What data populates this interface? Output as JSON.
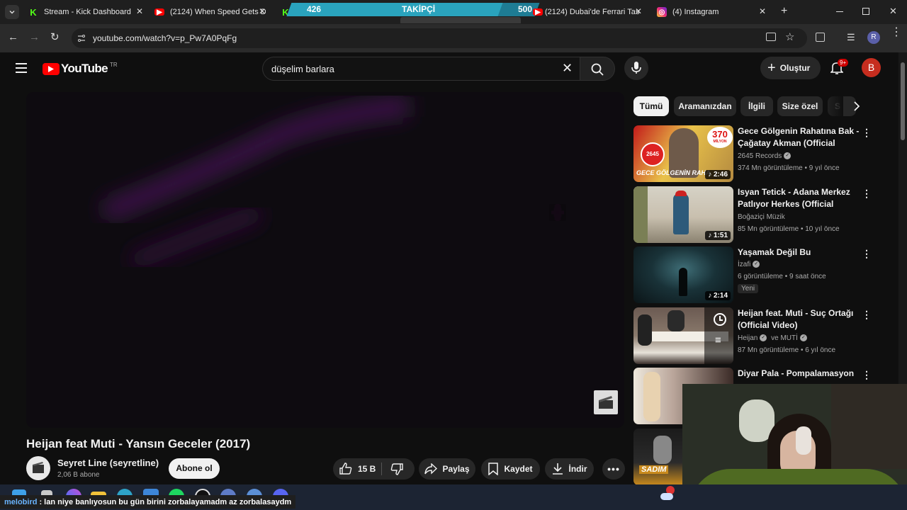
{
  "browser": {
    "tabs": [
      {
        "title": "Stream - Kick Dashboard",
        "icon": "kick-icon"
      },
      {
        "title": "(2124) When Speed Gets D",
        "icon": "youtube-icon"
      },
      {
        "title": "",
        "icon": "kick-icon"
      },
      {
        "title": "(2124) Dubai'de Ferrari Tas",
        "icon": "youtube-icon"
      },
      {
        "title": "(4) Instagram",
        "icon": "instagram-icon"
      }
    ],
    "url": "youtube.com/watch?v=p_Pw7A0PqFg",
    "profile_initial": "R"
  },
  "follow_overlay": {
    "current": "426",
    "label": "TAKİPÇİ",
    "goal": "500",
    "progress_fraction": 0.852
  },
  "youtube": {
    "logo_text": "YouTube",
    "region": "TR",
    "search_query": "düşelim barlara",
    "create_label": "Oluştur",
    "notifications_badge": "9+",
    "avatar_initial": "B"
  },
  "video": {
    "title": "Heijan feat Muti - Yansın Geceler (2017)",
    "channel_name": "Seyret Line (seyretline)",
    "subscribers": "2,06 B abone",
    "subscribe_label": "Abone ol",
    "likes": "15 B",
    "share_label": "Paylaş",
    "save_label": "Kaydet",
    "download_label": "İndir"
  },
  "chips": [
    "Tümü",
    "Aramanızdan",
    "İlgili",
    "Size özel",
    "S"
  ],
  "recommendations": [
    {
      "title": "Gece Gölgenin Rahatına Bak - Çağatay Akman (Official  Video)",
      "channel": "2645 Records",
      "verified": true,
      "meta": "374 Mn görüntüleme • 9 yıl önce",
      "duration": "2:46",
      "thumb_badge": "370",
      "thumb_badge_sub": "MİLYON",
      "thumb_text": "GECE GÖLGENİN RAHA",
      "thumb_logo": "2645",
      "badge": ""
    },
    {
      "title": "Isyan Tetick - Adana Merkez Patlıyor Herkes (Official Video)",
      "channel": "Boğaziçi Müzik",
      "verified": false,
      "meta": "85 Mn görüntüleme • 10 yıl önce",
      "duration": "1:51",
      "badge": ""
    },
    {
      "title": "Yaşamak Değil Bu",
      "channel": "İzafi",
      "verified": true,
      "meta": "6 görüntüleme • 9 saat önce",
      "duration": "2:14",
      "badge": "Yeni"
    },
    {
      "title": "Heijan feat. Muti - Suç Ortağı (Official Video)",
      "channel": "Heijan",
      "channel2": "ve MUTİ",
      "verified": true,
      "meta": "87 Mn görüntüleme • 6 yıl önce",
      "duration": "",
      "badge": ""
    },
    {
      "title": "Diyar Pala - Pompalamasyon",
      "channel": "",
      "verified": false,
      "meta": "",
      "duration": "",
      "badge": ""
    },
    {
      "title": "",
      "channel": "",
      "verified": false,
      "meta": "",
      "duration": "",
      "badge": "",
      "thumb_text": "SADIM"
    }
  ],
  "chat": {
    "user": "melobird",
    "message": ": lan niye banlıyosun bu gün birini zorbalayamadm az zorbalasaydm"
  },
  "colors": {
    "kick_green": "#53fc18",
    "youtube_red": "#ff0000",
    "follow_bar": "#2aa3bd",
    "avatar_bg": "#c62d1f"
  }
}
